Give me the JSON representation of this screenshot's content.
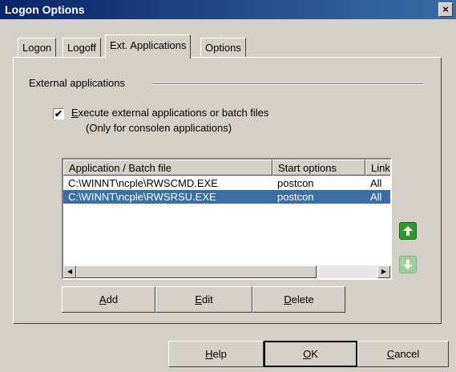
{
  "window": {
    "title": "Logon Options",
    "close": "×"
  },
  "tabs": [
    "Logon",
    "Logoff",
    "Ext. Applications",
    "Options"
  ],
  "group": {
    "title": "External applications"
  },
  "checkbox": {
    "checked": true,
    "mark": "✔",
    "label_key": "E",
    "label_rest": "xecute external applications or batch files",
    "sublabel": "(Only for consolen applications)"
  },
  "list": {
    "columns": [
      "Application / Batch file",
      "Start options",
      "Link"
    ],
    "rows": [
      [
        "C:\\WINNT\\ncple\\RWSCMD.EXE",
        "postcon",
        "All"
      ],
      [
        "C:\\WINNT\\ncple\\RWSRSU.EXE",
        "postcon",
        "All"
      ]
    ],
    "selected_row": 1
  },
  "buttons": {
    "add": {
      "key": "A",
      "rest": "dd"
    },
    "edit": {
      "key": "E",
      "rest": "dit"
    },
    "delete": {
      "key": "D",
      "rest": "elete"
    },
    "help": {
      "key": "H",
      "rest": "elp"
    },
    "ok": {
      "key": "O",
      "rest": "K"
    },
    "cancel": {
      "key": "C",
      "rest": "ancel"
    }
  },
  "icons": {
    "move_up": "up-arrow-icon",
    "move_down": "down-arrow-icon",
    "scroll_left": "left-arrow-icon",
    "scroll_right": "right-arrow-icon"
  },
  "colors": {
    "title_bar": "#0a246a",
    "selection": "#3a6ea5",
    "arrow_enabled": "#2e9a2e",
    "arrow_disabled": "#9ccf9c",
    "face": "#d4d0c8"
  }
}
